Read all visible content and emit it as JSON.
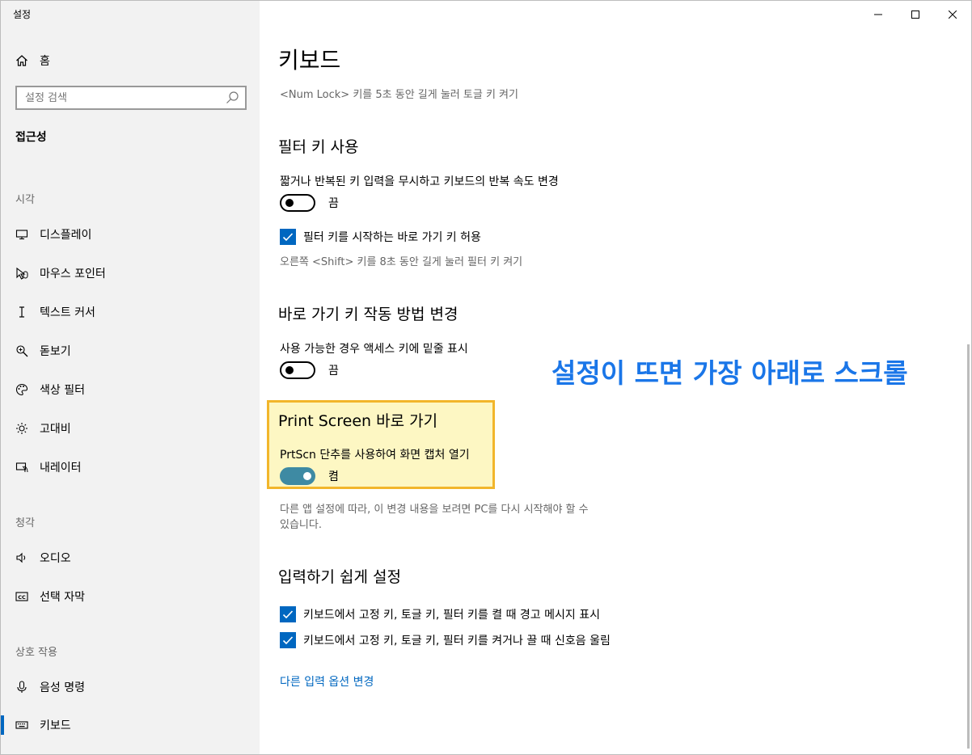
{
  "window": {
    "title": "설정"
  },
  "sidebar": {
    "home_label": "홈",
    "search_placeholder": "설정 검색",
    "section_title": "접근성",
    "groups": [
      {
        "label": "시각"
      },
      {
        "label": "청각"
      },
      {
        "label": "상호 작용"
      }
    ],
    "items": [
      {
        "label": "디스플레이",
        "icon": "monitor-icon"
      },
      {
        "label": "마우스 포인터",
        "icon": "mouse-pointer-icon"
      },
      {
        "label": "텍스트 커서",
        "icon": "text-cursor-icon"
      },
      {
        "label": "돋보기",
        "icon": "magnifier-icon"
      },
      {
        "label": "색상 필터",
        "icon": "palette-icon"
      },
      {
        "label": "고대비",
        "icon": "brightness-icon"
      },
      {
        "label": "내레이터",
        "icon": "narrator-icon"
      },
      {
        "label": "오디오",
        "icon": "speaker-icon"
      },
      {
        "label": "선택 자막",
        "icon": "closed-caption-icon"
      },
      {
        "label": "음성 명령",
        "icon": "microphone-icon"
      },
      {
        "label": "키보드",
        "icon": "keyboard-icon",
        "active": true
      }
    ]
  },
  "main": {
    "title": "키보드",
    "numlock_desc": "<Num Lock> 키를 5초 동안 길게 눌러 토글 키 켜기",
    "filter_keys": {
      "heading": "필터 키 사용",
      "description": "짧거나 반복된 키 입력을 무시하고 키보드의 반복 속도 변경",
      "toggle_state": "끔",
      "checkbox_label": "필터 키를 시작하는 바로 가기 키 허용",
      "shortcut_desc": "오른쪽 <Shift> 키를 8초 동안 길게 눌러 필터 키 켜기"
    },
    "shortcut_behavior": {
      "heading": "바로 가기 키 작동 방법 변경",
      "description": "사용 가능한 경우 액세스 키에 밑줄 표시",
      "toggle_state": "끔"
    },
    "print_screen": {
      "heading": "Print Screen 바로 가기",
      "description": "PrtScn 단추를 사용하여 화면 캡처 열기",
      "toggle_state": "켬",
      "note_line1": "다른 앱 설정에 따라, 이 변경 내용을 보려면 PC를 다시 시작해야 할 수",
      "note_line2": "있습니다."
    },
    "typing": {
      "heading": "입력하기 쉽게 설정",
      "checkbox1": "키보드에서 고정 키, 토글 키, 필터 키를 켤 때 경고 메시지 표시",
      "checkbox2": "키보드에서 고정 키, 토글 키, 필터 키를 켜거나 끌 때 신호음 울림"
    },
    "link": "다른 입력 옵션 변경"
  },
  "annotation": "설정이 뜨면 가장 아래로 스크롤",
  "colors": {
    "accent": "#0067c0",
    "toggle_on": "#3e8aa3",
    "highlight_border": "#f2b62b",
    "highlight_fill": "#fdf7c3",
    "annotation": "#1a76e8"
  }
}
